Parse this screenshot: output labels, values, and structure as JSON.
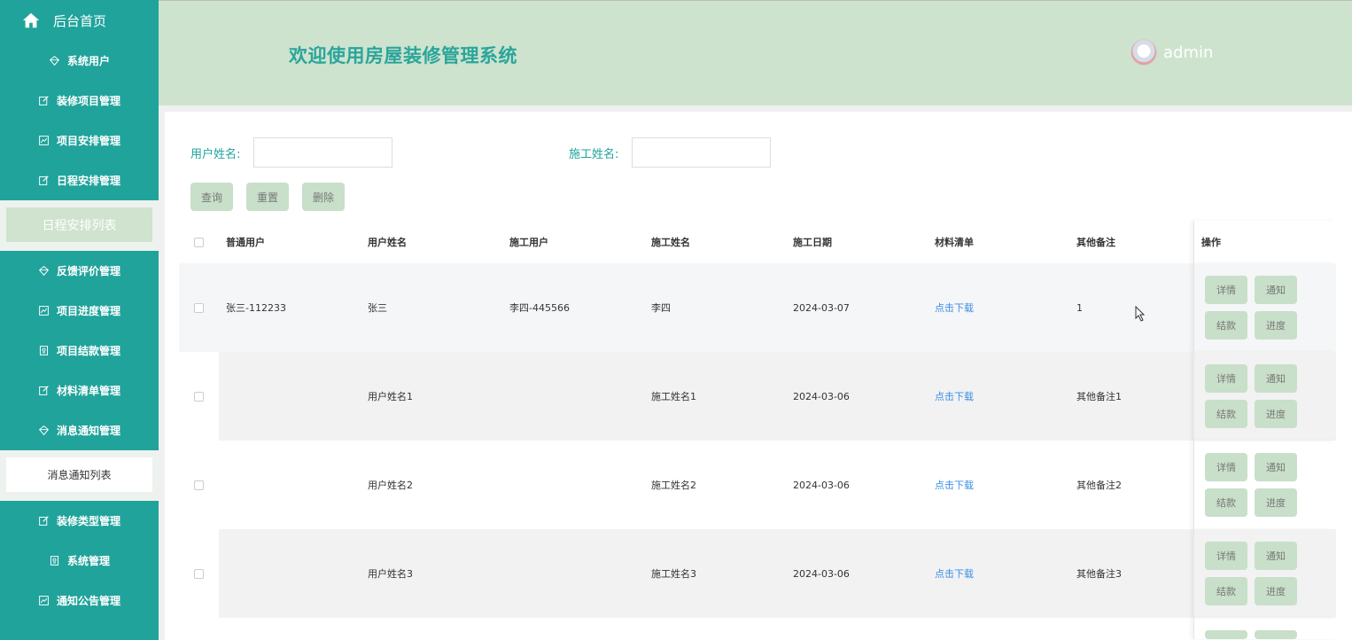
{
  "sidebar": {
    "home_label": "后台首页",
    "items": [
      {
        "label": "系统用户",
        "icon": "diamond-icon"
      },
      {
        "label": "装修项目管理",
        "icon": "edit-icon"
      },
      {
        "label": "项目安排管理",
        "icon": "chart-icon"
      },
      {
        "label": "日程安排管理",
        "icon": "edit-icon"
      }
    ],
    "active_sub": "日程安排列表",
    "items2": [
      {
        "label": "反馈评价管理",
        "icon": "diamond-icon"
      },
      {
        "label": "项目进度管理",
        "icon": "chart-icon"
      },
      {
        "label": "项目结款管理",
        "icon": "badge-icon"
      },
      {
        "label": "材料清单管理",
        "icon": "edit-icon"
      },
      {
        "label": "消息通知管理",
        "icon": "diamond-icon"
      }
    ],
    "light_sub": "消息通知列表",
    "items3": [
      {
        "label": "装修类型管理",
        "icon": "edit-icon"
      },
      {
        "label": "系统管理",
        "icon": "badge-icon"
      },
      {
        "label": "通知公告管理",
        "icon": "chart-icon"
      }
    ]
  },
  "header": {
    "title": "欢迎使用房屋装修管理系统",
    "username": "admin"
  },
  "search": {
    "user_name_label": "用户姓名:",
    "user_name_value": "",
    "worker_name_label": "施工姓名:",
    "worker_name_value": ""
  },
  "buttons": {
    "query": "查询",
    "reset": "重置",
    "delete": "删除"
  },
  "table": {
    "headers": [
      "普通用户",
      "用户姓名",
      "施工用户",
      "施工姓名",
      "施工日期",
      "材料清单",
      "其他备注",
      "操作"
    ],
    "rows": [
      {
        "normal_user": "张三-112233",
        "user_name": "张三",
        "worker_user": "李四-445566",
        "worker_name": "李四",
        "date": "2024-03-07",
        "materials": "点击下载",
        "remark": "1"
      },
      {
        "normal_user": "",
        "user_name": "用户姓名1",
        "worker_user": "",
        "worker_name": "施工姓名1",
        "date": "2024-03-06",
        "materials": "点击下载",
        "remark": "其他备注1"
      },
      {
        "normal_user": "",
        "user_name": "用户姓名2",
        "worker_user": "",
        "worker_name": "施工姓名2",
        "date": "2024-03-06",
        "materials": "点击下载",
        "remark": "其他备注2"
      },
      {
        "normal_user": "",
        "user_name": "用户姓名3",
        "worker_user": "",
        "worker_name": "施工姓名3",
        "date": "2024-03-06",
        "materials": "点击下载",
        "remark": "其他备注3"
      }
    ],
    "actions": {
      "detail": "详情",
      "notify": "通知",
      "settle": "结款",
      "progress": "进度"
    }
  }
}
